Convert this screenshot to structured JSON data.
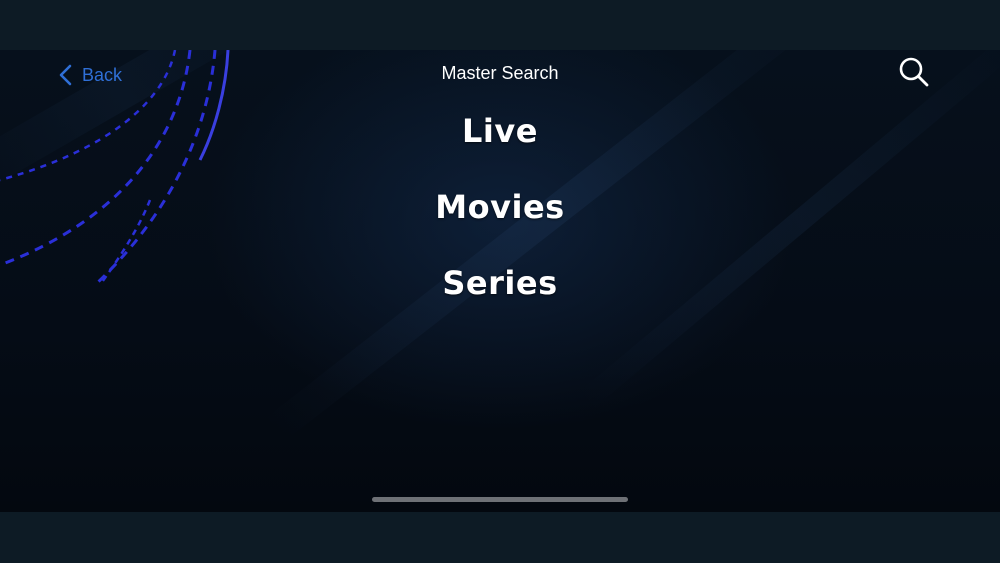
{
  "nav": {
    "back_label": "Back",
    "title": "Master Search"
  },
  "menu": {
    "items": [
      {
        "label": "Live"
      },
      {
        "label": "Movies"
      },
      {
        "label": "Series"
      }
    ]
  },
  "icons": {
    "back": "chevron-left-icon",
    "search": "search-icon"
  },
  "colors": {
    "accent": "#2f6fd6",
    "text": "#ffffff",
    "background": "#050c16",
    "letterbox": "#0d1b25"
  }
}
